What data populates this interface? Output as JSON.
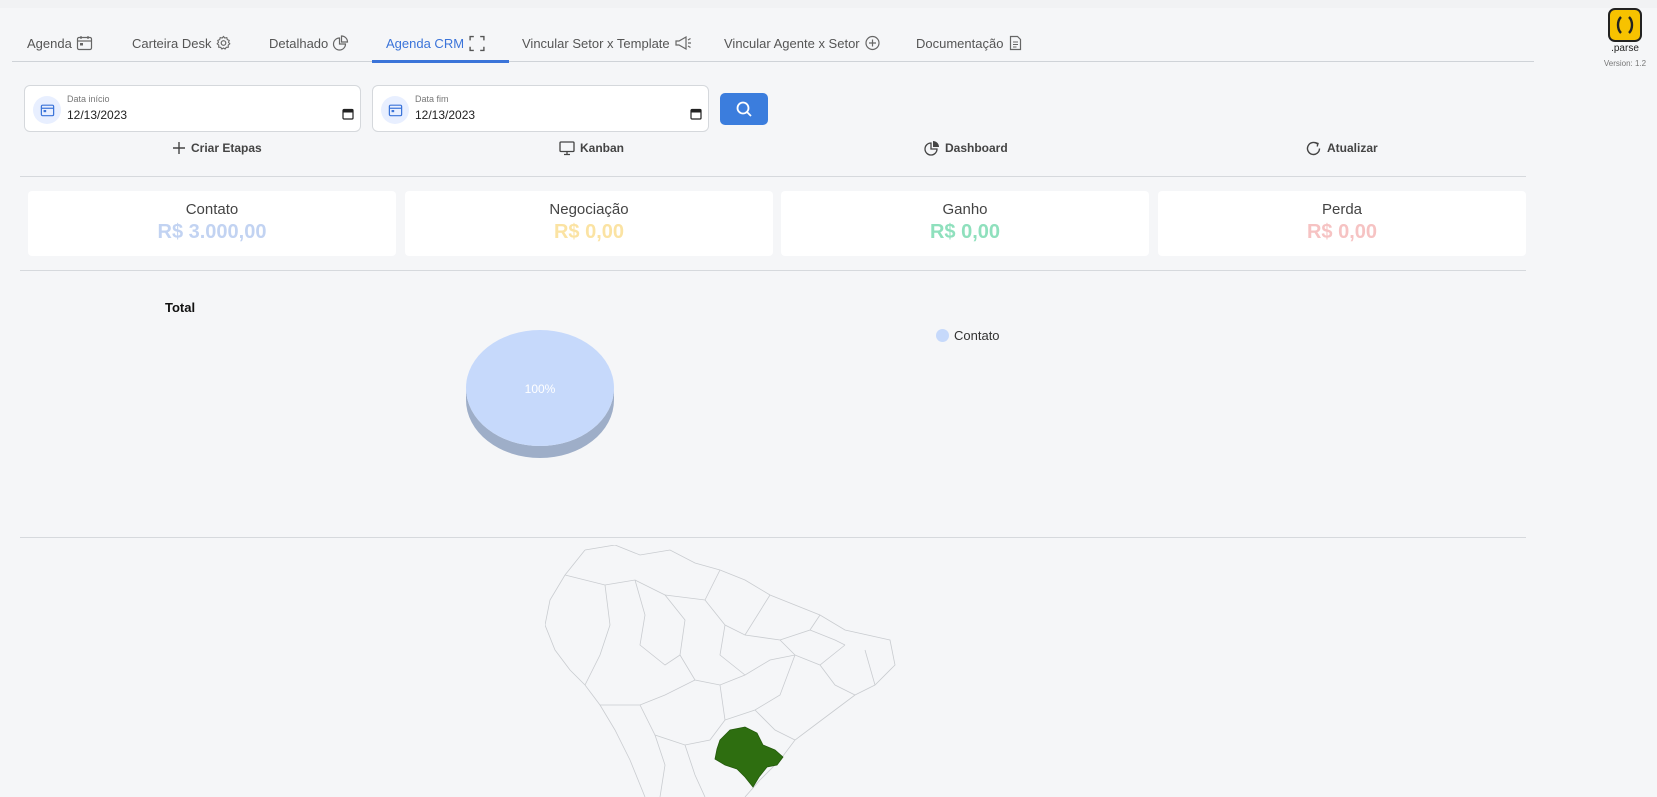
{
  "tabs": [
    {
      "label": "Agenda",
      "icon": "calendar-icon"
    },
    {
      "label": "Carteira Desk",
      "icon": "gear-icon"
    },
    {
      "label": "Detalhado",
      "icon": "pie-chart-icon"
    },
    {
      "label": "Agenda CRM",
      "icon": "expand-icon",
      "active": true
    },
    {
      "label": "Vincular Setor x Template",
      "icon": "megaphone-icon"
    },
    {
      "label": "Vincular Agente x Setor",
      "icon": "plus-circle-icon"
    },
    {
      "label": "Documentação",
      "icon": "document-icon"
    }
  ],
  "brand": {
    "name": ".parse",
    "version": "Version: 1.2"
  },
  "filters": {
    "start": {
      "label": "Data início",
      "value": "12/13/2023"
    },
    "end": {
      "label": "Data fim",
      "value": "12/13/2023"
    }
  },
  "actions": [
    {
      "label": "Criar Etapas",
      "icon": "plus-icon"
    },
    {
      "label": "Kanban",
      "icon": "monitor-icon"
    },
    {
      "label": "Dashboard",
      "icon": "pie-chart-icon"
    },
    {
      "label": "Atualizar",
      "icon": "refresh-icon"
    }
  ],
  "cards": [
    {
      "title": "Contato",
      "amount": "R$ 3.000,00",
      "color": "#c2d3f2"
    },
    {
      "title": "Negociação",
      "amount": "R$ 0,00",
      "color": "#fbe3a3"
    },
    {
      "title": "Ganho",
      "amount": "R$ 0,00",
      "color": "#8fe0bd"
    },
    {
      "title": "Perda",
      "amount": "R$ 0,00",
      "color": "#f6c3c3"
    }
  ],
  "colors": {
    "accent": "#3b74d9",
    "button": "#3b7ddd",
    "pie_top": "#c6d9fb",
    "pie_side": "#9eaec8",
    "map_highlight": "#2e6e10"
  },
  "chart_data": {
    "type": "pie",
    "title": "Total",
    "categories": [
      "Contato"
    ],
    "values": [
      100
    ],
    "labels": [
      "100%"
    ],
    "legend": "right"
  }
}
